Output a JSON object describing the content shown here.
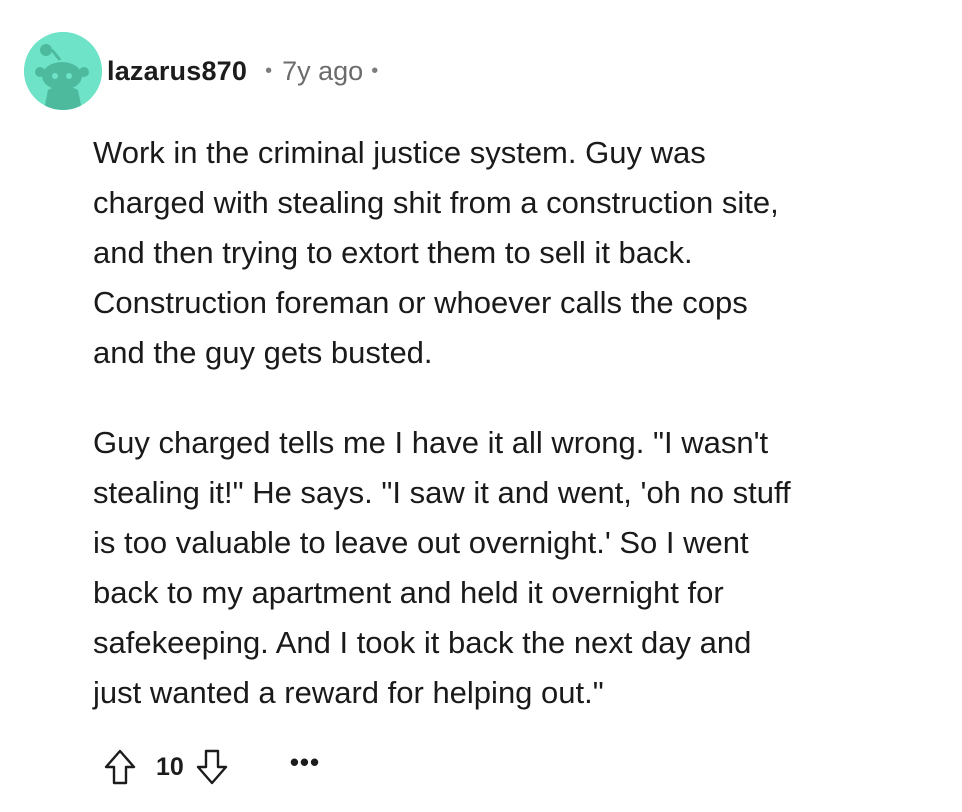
{
  "comment": {
    "author": "lazarus870",
    "separator": "•",
    "time_ago": "7y ago",
    "paragraphs": [
      "Work in the criminal justice system. Guy was\ncharged with stealing shit from a construction site,\nand then trying to extort them to sell it back.\nConstruction foreman or whoever calls the cops\nand the guy gets busted.",
      "Guy charged tells me I have it all wrong. \"I wasn't\nstealing it!\" He says. \"I saw it and went, 'oh no stuff\nis too valuable to leave out overnight.' So I went\nback to my apartment and held it overnight for\nsafekeeping. And I took it back the next day and\njust wanted a reward for helping out.\""
    ],
    "vote_score": "10",
    "more_label": "•••"
  },
  "icons": {
    "avatar": "snoo-avatar-icon",
    "upvote": "upvote-arrow-icon",
    "downvote": "downvote-arrow-icon",
    "more": "more-options-icon"
  },
  "colors": {
    "avatar_background": "#6fe3c8",
    "text": "#1c1c1c",
    "muted": "#6b6b6b"
  }
}
